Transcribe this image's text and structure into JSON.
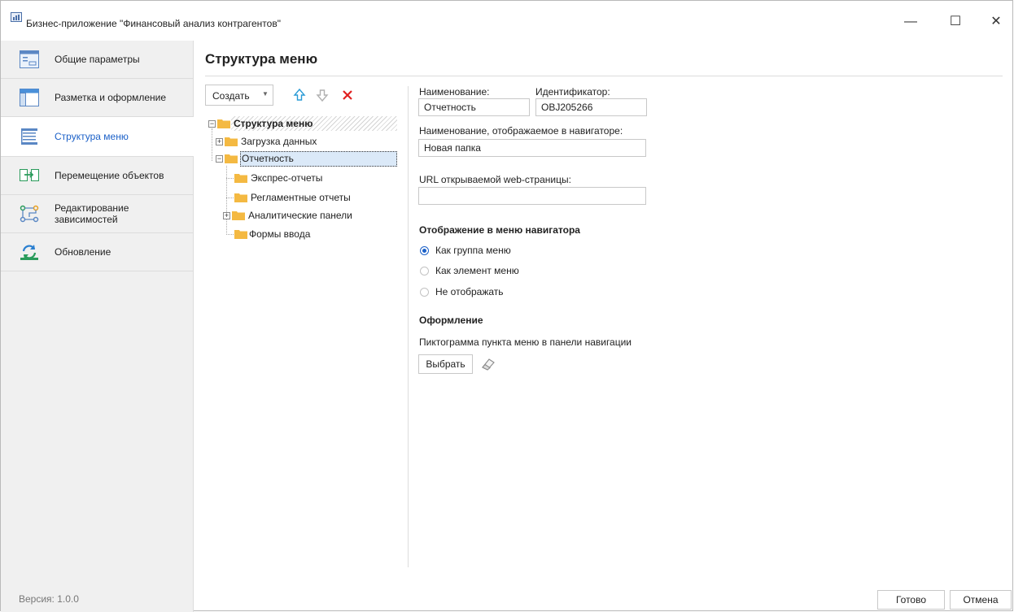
{
  "window": {
    "title": "Бизнес-приложение \"Финансовый анализ контрагентов\"",
    "controls": {
      "minimize": "—",
      "maximize": "☐",
      "close": "✕"
    }
  },
  "sidebar": {
    "items": [
      {
        "label": "Общие параметры",
        "icon": "settings-form-icon"
      },
      {
        "label": "Разметка и оформление",
        "icon": "layout-icon"
      },
      {
        "label": "Структура меню",
        "icon": "menu-structure-icon",
        "selected": true
      },
      {
        "label": "Перемещение объектов",
        "icon": "move-objects-icon"
      },
      {
        "label": "Редактирование зависимостей",
        "icon": "dependencies-icon"
      },
      {
        "label": "Обновление",
        "icon": "update-icon"
      }
    ],
    "version": "Версия: 1.0.0"
  },
  "main": {
    "title": "Структура меню",
    "toolbar": {
      "create_label": "Создать",
      "move_up": "up-arrow-icon",
      "move_down": "down-arrow-icon",
      "delete": "delete-icon"
    },
    "tree": {
      "root": "Структура меню",
      "items": [
        {
          "label": "Загрузка данных",
          "expandable": true,
          "expanded": false
        },
        {
          "label": "Отчетность",
          "expandable": true,
          "expanded": true,
          "selected": true
        },
        {
          "label": "Экспрес-отчеты"
        },
        {
          "label": "Регламентные отчеты"
        },
        {
          "label": "Аналитические панели",
          "expandable": true,
          "expanded": false
        },
        {
          "label": "Формы ввода"
        }
      ]
    },
    "form": {
      "name_label": "Наименование:",
      "name_value": "Отчетность",
      "id_label": "Идентификатор:",
      "id_value": "OBJ205266",
      "nav_name_label": "Наименование, отображаемое в навигаторе:",
      "nav_name_value": "Новая папка",
      "url_label": "URL открываемой web-страницы:",
      "url_value": "",
      "display_section": "Отображение в меню навигатора",
      "display_options": [
        {
          "label": "Как группа меню",
          "checked": true
        },
        {
          "label": "Как элемент меню",
          "checked": false
        },
        {
          "label": "Не отображать",
          "checked": false
        }
      ],
      "design_section": "Оформление",
      "icon_label": "Пиктограмма пункта меню в панели навигации",
      "choose_label": "Выбрать"
    }
  },
  "footer": {
    "done_label": "Готово",
    "cancel_label": "Отмена"
  },
  "colors": {
    "accent": "#1c61c8",
    "folder": "#f4b942",
    "sidebar_bg": "#f0f0f0",
    "delete": "#e02020",
    "up_arrow": "#2a9bd6"
  }
}
